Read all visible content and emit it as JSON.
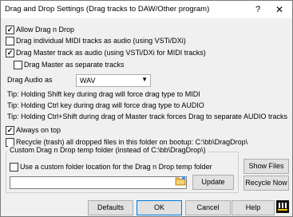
{
  "window": {
    "title": "Drag and Drop Settings (Drag tracks to DAW/Other program)",
    "help_glyph": "?",
    "close_glyph": "✕"
  },
  "options": {
    "allow": {
      "label": "Allow Drag n Drop",
      "checked": true
    },
    "individual_midi": {
      "label": "Drag individual MIDI tracks as audio (using VSTi/DXi)",
      "checked": false
    },
    "master_audio": {
      "label": "Drag Master track as audio (using VSTi/DXi for MIDI tracks)",
      "checked": true
    },
    "master_separate": {
      "label": "Drag Master as separate tracks",
      "checked": false
    },
    "always_on_top": {
      "label": "Always on top",
      "checked": true
    },
    "recycle": {
      "label": "Recycle (trash) all dropped files in this folder on bootup:  C:\\bb\\DragDrop\\",
      "checked": false
    },
    "custom_folder": {
      "label": "Use a custom folder location for the Drag n Drop temp folder",
      "checked": false
    }
  },
  "drag_audio": {
    "label": "Drag Audio as",
    "value": "WAV"
  },
  "tips": [
    "Tip: Holding Shift key during drag will force drag type to MIDI",
    "Tip: Holding Ctrl key during drag will force drag type to AUDIO",
    "Tip: Holding Ctrl+Shift during drag of Master track forces Drag to separate AUDIO tracks"
  ],
  "temp_group": {
    "title": "Custom Drag n Drop temp folder (instead of   C:\\bb\\DragDrop\\)",
    "input_value": ""
  },
  "buttons": {
    "show_files": "Show Files",
    "recycle_now": "Recycle Now",
    "update": "Update",
    "defaults": "Defaults",
    "ok": "OK",
    "cancel": "Cancel",
    "help": "Help"
  },
  "check_glyph": "✓",
  "icons": {
    "folder": "folder-icon",
    "logo": "band-in-a-box-logo"
  }
}
